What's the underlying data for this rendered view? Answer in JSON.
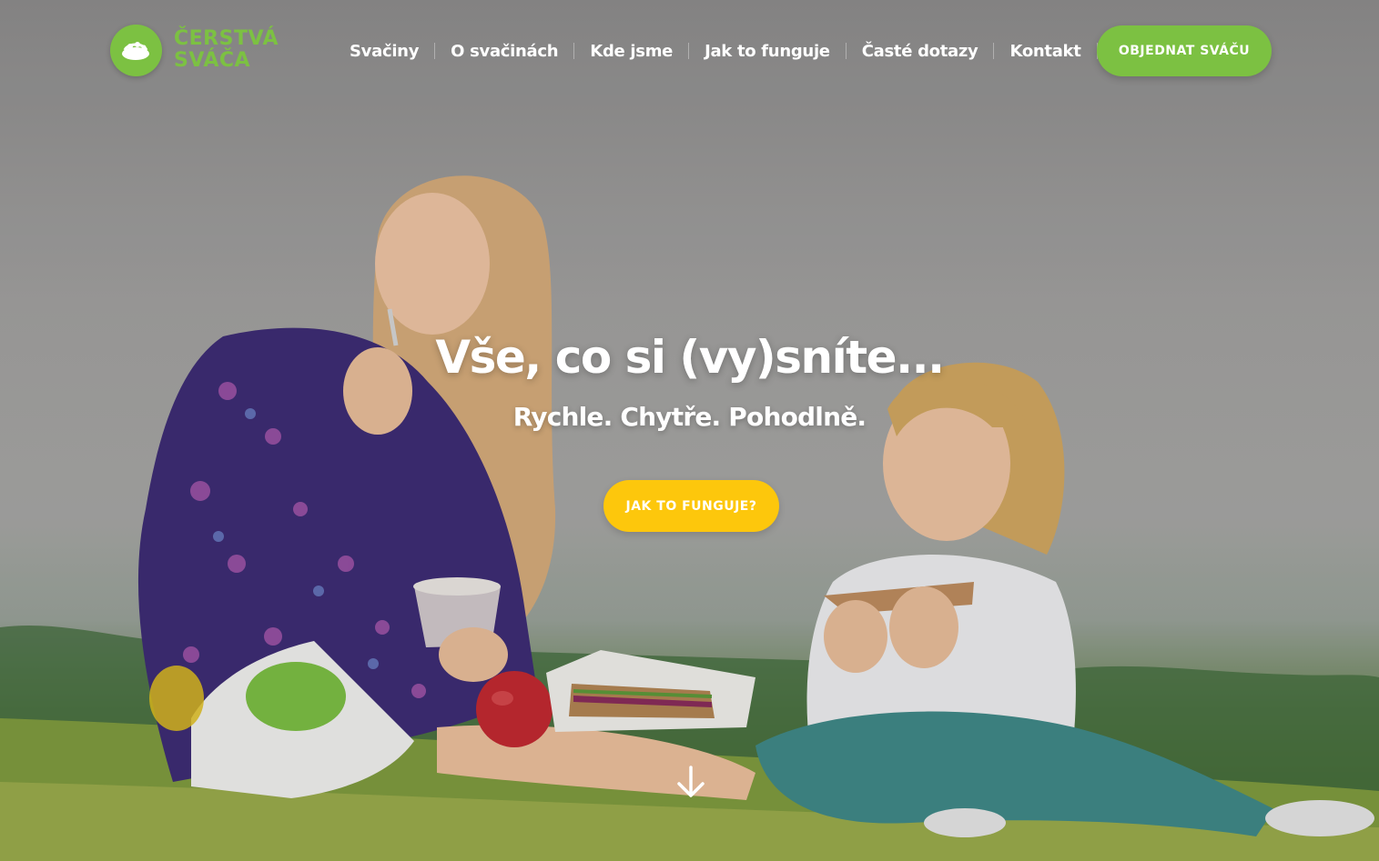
{
  "brand": {
    "name_line1": "ČERSTVÁ",
    "name_line2": "SVÁČA",
    "color": "#7cc142"
  },
  "nav": {
    "items": [
      {
        "label": "Svačiny"
      },
      {
        "label": "O svačinách"
      },
      {
        "label": "Kde jsme"
      },
      {
        "label": "Jak to funguje"
      },
      {
        "label": "Časté dotazy"
      },
      {
        "label": "Kontakt"
      }
    ],
    "language_icon": "czech-flag-icon"
  },
  "header": {
    "order_button_label": "OBJEDNAT SVÁČU"
  },
  "hero": {
    "headline": "Vše, co si (vy)sníte...",
    "subheadline": "Rychle. Chytře. Pohodlně.",
    "cta_label": "JAK TO FUNGUJE?",
    "cta_color": "#fdc70c",
    "scroll_icon": "arrow-down-icon"
  }
}
